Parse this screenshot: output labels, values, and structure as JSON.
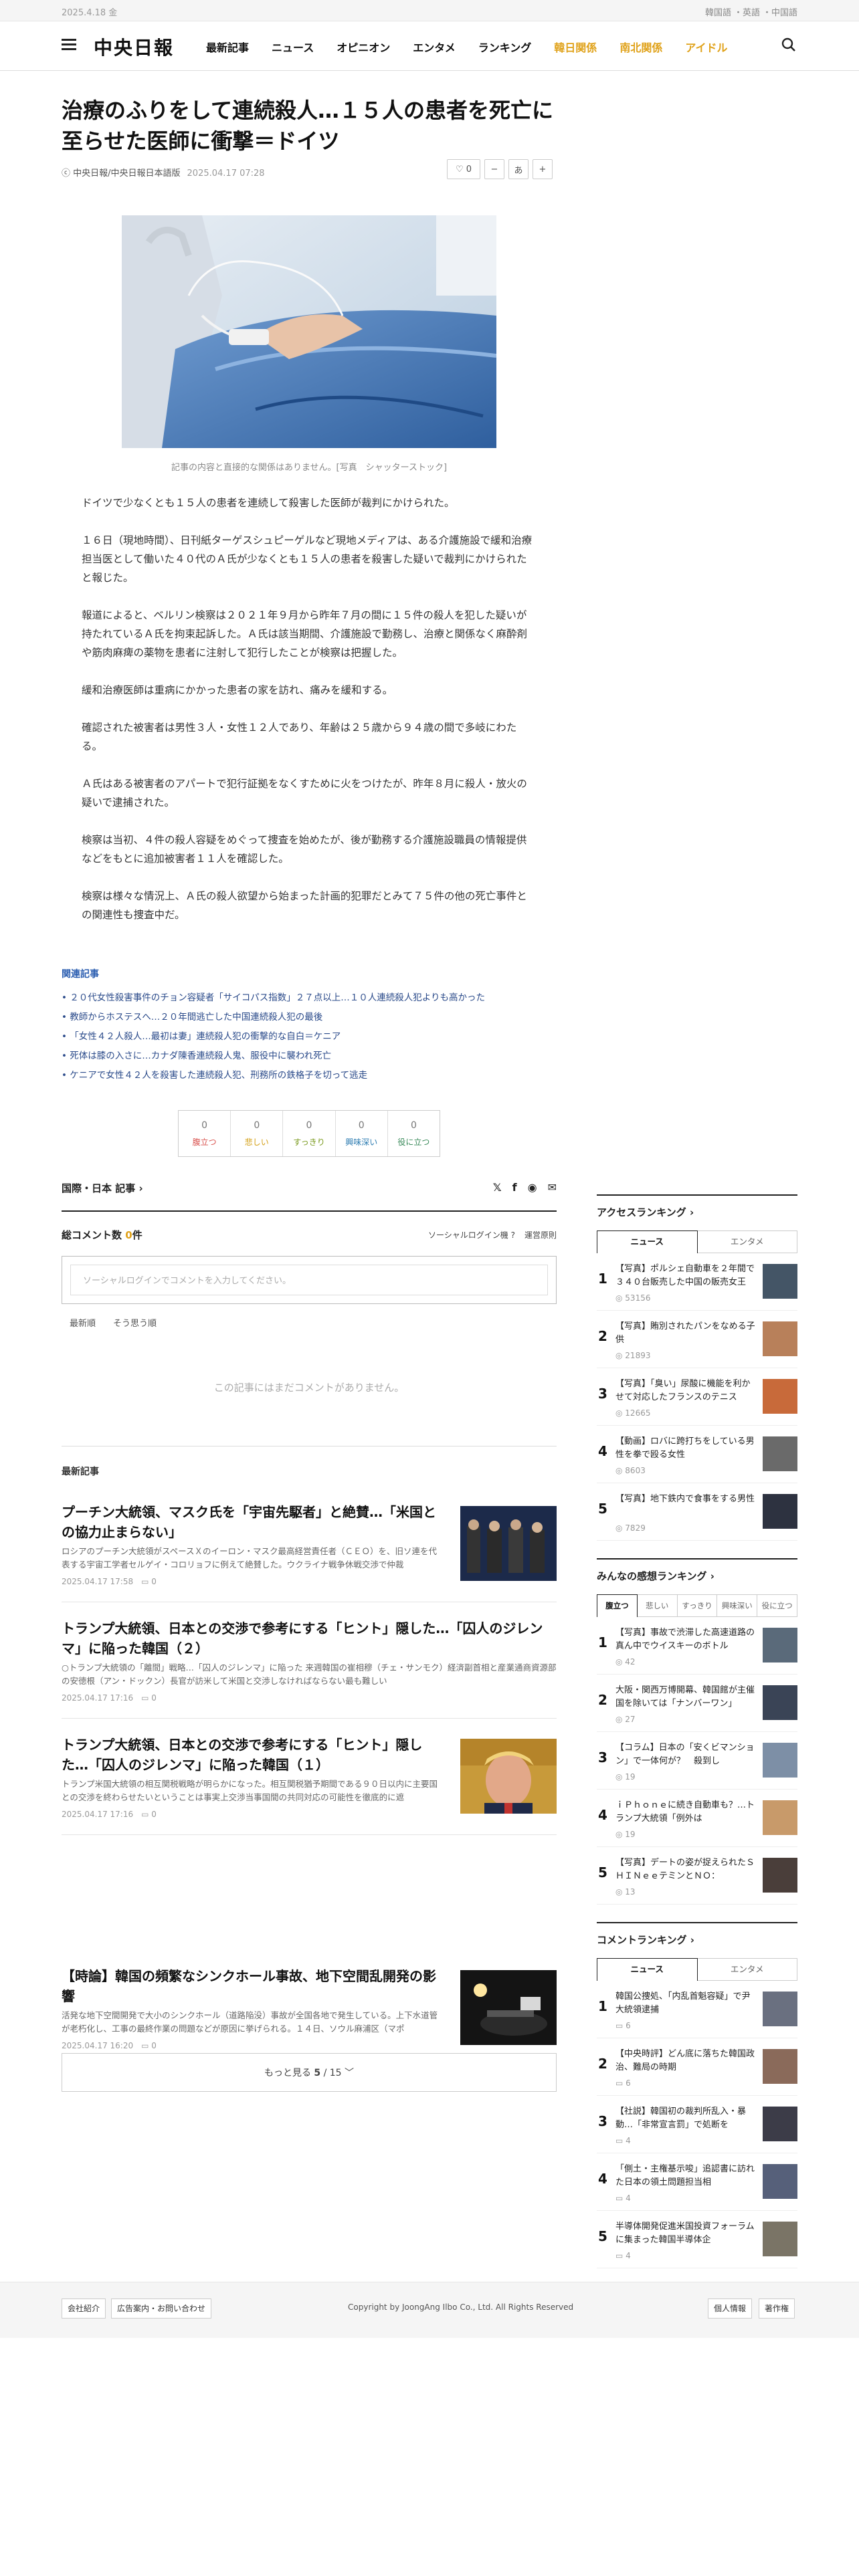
{
  "topbar": {
    "date": "2025.4.18 金",
    "langs": [
      "韓国語",
      "・英語",
      "・中国語"
    ]
  },
  "header": {
    "logo": "中央日報",
    "nav": [
      "最新記事",
      "ニュース",
      "オピニオン",
      "エンタメ",
      "ランキング"
    ],
    "nav_highlight": [
      "韓日関係",
      "南北関係",
      "アイドル"
    ]
  },
  "article": {
    "title": "治療のふりをして連続殺人…１５人の患者を死亡に至らせた医師に衝撃＝ドイツ",
    "source": "中央日報/中央日報日本語版",
    "datetime": "2025.04.17 07:28",
    "like_count": "0",
    "font_label": "あ",
    "caption": "記事の内容と直接的な関係はありません。[写真　シャッターストック]",
    "paragraphs": [
      "ドイツで少なくとも１５人の患者を連続して殺害した医師が裁判にかけられた。",
      "１６日（現地時間）、日刊紙ターゲスシュピーゲルなど現地メディアは、ある介護施設で緩和治療担当医として働いた４０代のＡ氏が少なくとも１５人の患者を殺害した疑いで裁判にかけられたと報じた。",
      "報道によると、ベルリン検察は２０２１年９月から昨年７月の間に１５件の殺人を犯した疑いが持たれているＡ氏を拘束起訴した。Ａ氏は該当期間、介護施設で勤務し、治療と関係なく麻酔剤や筋肉麻痺の薬物を患者に注射して犯行したことが検察は把握した。",
      "緩和治療医師は重病にかかった患者の家を訪れ、痛みを緩和する。",
      "確認された被害者は男性３人・女性１２人であり、年齢は２５歳から９４歳の間で多岐にわたる。",
      "Ａ氏はある被害者のアパートで犯行証拠をなくすために火をつけたが、昨年８月に殺人・放火の疑いで逮捕された。",
      "検察は当初、４件の殺人容疑をめぐって捜査を始めたが、後が勤務する介護施設職員の情報提供などをもとに追加被害者１１人を確認した。",
      "検察は様々な情況上、Ａ氏の殺人欲望から始まった計画的犯罪だとみて７５件の他の死亡事件との関連性も捜査中だ。"
    ]
  },
  "related": {
    "label": "関連記事",
    "items": [
      "２０代女性殺害事件のチョン容疑者「サイコパス指数」２７点以上…１０人連続殺人犯よりも高かった",
      "教師からホステスへ…２０年間逃亡した中国連続殺人犯の最後",
      "「女性４２人殺人…最初は妻」連続殺人犯の衝撃的な自白＝ケニア",
      "死体は膝の入さに…カナダ陳香連続殺人鬼、服役中に襲われ死亡",
      "ケニアで女性４２人を殺害した連続殺人犯、刑務所の鉄格子を切って逃走"
    ]
  },
  "reactions": [
    {
      "count": "0",
      "label": "腹立つ",
      "color": "#d9534f"
    },
    {
      "count": "0",
      "label": "悲しい",
      "color": "#d4a017"
    },
    {
      "count": "0",
      "label": "すっきり",
      "color": "#7a9a1e"
    },
    {
      "count": "0",
      "label": "興味深い",
      "color": "#2a7ab0"
    },
    {
      "count": "0",
      "label": "役に立つ",
      "color": "#3a8a5a"
    }
  ],
  "section": {
    "label": "国際・日本 記事 ›"
  },
  "comments": {
    "total_label": "総コメント数",
    "total": "0",
    "unit": "件",
    "social_login": "ソーシャルログイン機 ?",
    "order": "運営原則",
    "placeholder": "ソーシャルログインでコメントを入力してください。",
    "tabs": [
      "最新順",
      "そう思う順"
    ],
    "empty": "この記事にはまだコメントがありません。"
  },
  "latest": {
    "label": "最新記事",
    "items": [
      {
        "title": "プーチン大統領、マスク氏を「宇宙先駆者」と絶賛…「米国との協力止まらない」",
        "excerpt": "ロシアのプーチン大統領がスペースＸのイーロン・マスク最高経営責任者（ＣＥＯ）を、旧ソ連を代表する宇宙工学者セルゲイ・コロリョフに例えて絶賛した。ウクライナ戦争休戦交渉で仲裁",
        "time": "2025.04.17 17:58",
        "comments": "0"
      },
      {
        "title": "トランプ大統領、日本との交渉で参考にする「ヒント」隠した…「囚人のジレンマ」に陥った韓国（２）",
        "excerpt": "○トランプ大統領の「離間」戦略…「囚人のジレンマ」に陥った 来週韓国の崔相穆（チェ・サンモク）経済副首相と産業通商資源部の安徳根（アン・ドックン）長官が訪米して米国と交渉しなければならない最も難しい",
        "time": "2025.04.17 17:16",
        "comments": "0"
      },
      {
        "title": "トランプ大統領、日本との交渉で参考にする「ヒント」隠した…「囚人のジレンマ」に陥った韓国（１）",
        "excerpt": "トランプ米国大統領の相互関税戦略が明らかになった。相互関税猶予期間である９０日以内に主要国との交渉を終わらせたいということは事実上交渉当事国間の共同対応の可能性を徹底的に遮",
        "time": "2025.04.17 17:16",
        "comments": "0"
      },
      {
        "title": "【時論】韓国の頻繁なシンクホール事故、地下空間乱開発の影響",
        "excerpt": "活発な地下空間開発で大小のシンクホール（道路陥没）事故が全国各地で発生している。上下水道管が老朽化し、工事の最終作業の問題などが原因に挙げられる。１４日、ソウル麻浦区（マポ",
        "time": "2025.04.17 16:20",
        "comments": "0"
      }
    ],
    "more_label": "もっと見る",
    "more_page": "5",
    "more_total": "/ 15"
  },
  "sidebar": {
    "access": {
      "title": "アクセスランキング ›",
      "tabs": [
        "ニュース",
        "エンタメ"
      ],
      "items": [
        {
          "no": "1",
          "text": "【写真】ポルシェ自動車を２年間で３４０台販売した中国の販売女王",
          "views": "53156"
        },
        {
          "no": "2",
          "text": "【写真】賄別されたパンをなめる子供",
          "views": "21893"
        },
        {
          "no": "3",
          "text": "【写真】「臭い」尿酸に機能を利かせて対応したフランスのテニス",
          "views": "12665"
        },
        {
          "no": "4",
          "text": "【動画】ロバに跨打ちをしている男性を拳で殴る女性",
          "views": "8603"
        },
        {
          "no": "5",
          "text": "【写真】地下鉄内で食事をする男性",
          "views": "7829"
        }
      ]
    },
    "emotion": {
      "title": "みんなの感想ランキング ›",
      "tabs": [
        "腹立つ",
        "悲しい",
        "すっきり",
        "興味深い",
        "役に立つ"
      ],
      "items": [
        {
          "no": "1",
          "text": "【写真】事故で渋滞した高速道路の真ん中でウイスキーのボトル",
          "views": "42"
        },
        {
          "no": "2",
          "text": "大阪・関西万博開幕、韓国館が主催国を除いては「ナンバーワン」",
          "views": "27"
        },
        {
          "no": "3",
          "text": "【コラム】日本の「安くビマンション」で一体何が？　殺到し",
          "views": "19"
        },
        {
          "no": "4",
          "text": "ｉＰｈｏｎｅに続き自動車も？…トランプ大統領「例外は",
          "views": "19"
        },
        {
          "no": "5",
          "text": "【写真】デートの姿が捉えられたＳＨＩＮｅｅテミンとＮＯ：",
          "views": "13"
        }
      ]
    },
    "comment": {
      "title": "コメントランキング ›",
      "tabs": [
        "ニュース",
        "エンタメ"
      ],
      "items": [
        {
          "no": "1",
          "text": "韓国公捜処、「内乱首魁容疑」で尹大統領逮捕",
          "views": "6"
        },
        {
          "no": "2",
          "text": "【中央時評】どん底に落ちた韓国政治、難局の時期",
          "views": "6"
        },
        {
          "no": "3",
          "text": "【社説】韓国初の裁判所乱入・暴動…「非常宣言罰」で処断を",
          "views": "4"
        },
        {
          "no": "4",
          "text": "「側土・主権基示唆」追認書に訪れた日本の領土問題担当相",
          "views": "4"
        },
        {
          "no": "5",
          "text": "半導体開発促進米国投資フォーラムに集まった韓国半導体企",
          "views": "4"
        }
      ]
    }
  },
  "footer": {
    "left_buttons": [
      "会社紹介",
      "広告案内・お問い合わせ"
    ],
    "copyright": "Copyright by JoongAng Ilbo Co., Ltd. All Rights Reserved",
    "right_buttons": [
      "個人情報",
      "著作権"
    ]
  }
}
